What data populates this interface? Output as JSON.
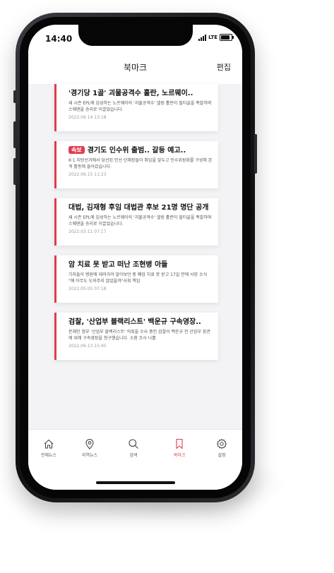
{
  "status": {
    "time": "14:40",
    "network": "LTE"
  },
  "header": {
    "title": "북마크",
    "edit_label": "편집"
  },
  "bookmarks": [
    {
      "title": "'경기당 1골' 괴물공격수 홀란, 노르웨이..",
      "badge": "",
      "summary": "새 시즌 EPL에 입성하는 노르웨이의 '괴물공격수' 엘링 홀란이 될티골을 폭발하며 스웨덴을 승리로 이끌었습니다.",
      "date": "2022.06.14  13:18"
    },
    {
      "title": "경기도 인수위 출범.. 갈등 예고..",
      "badge": "속보",
      "summary": "6·1 지방선거에서 당선된 민선 단체장들이 취임을 앞두고 인수위원회를 구성해 본격 활동에 들어갔습니다.",
      "date": "2022.06.15  11:23"
    },
    {
      "title": "대법, 김재형 후임 대법관 후보 21명 명단 공개",
      "badge": "",
      "summary": "새 시즌 EPL에 입성하는 노르웨이의 '괴물공격수' 엘링 홀란이 될티골을 폭발하며 스웨덴을 승리로 이끌었습니다.",
      "date": "2022.03.11  07:17"
    },
    {
      "title": "암 치료 못 받고 떠난 조현병 아들",
      "badge": "",
      "summary": "기자들이 병원에 데려가려 알아보던 중 폐암 치료 못 받고 17일 만에 사망 소식 \"예 아무도 도와주지 않았을까\"사회 책임",
      "date": "2022.05.05  07:18"
    },
    {
      "title": "검찰, '산업부 블랙리스트' 백운규 구속영장..",
      "badge": "",
      "summary": "문재인 정부 '산업부 블랙리스트' 의혹을 수사 중인 검찰이 백운규 전 산업부 장관에 대해 구속영장을 청구했습니다. 소환 조사 나흘",
      "date": "2022.06.13  15:45"
    }
  ],
  "tabbar": {
    "items": [
      {
        "label": "전체뉴스",
        "icon": "home-icon"
      },
      {
        "label": "지역뉴스",
        "icon": "location-pin-icon"
      },
      {
        "label": "검색",
        "icon": "search-icon"
      },
      {
        "label": "북마크",
        "icon": "bookmark-icon",
        "active": true
      },
      {
        "label": "설정",
        "icon": "gear-icon"
      }
    ]
  },
  "colors": {
    "accent": "#e23a4c",
    "background": "#f3f3f5",
    "frame": "#121315"
  }
}
